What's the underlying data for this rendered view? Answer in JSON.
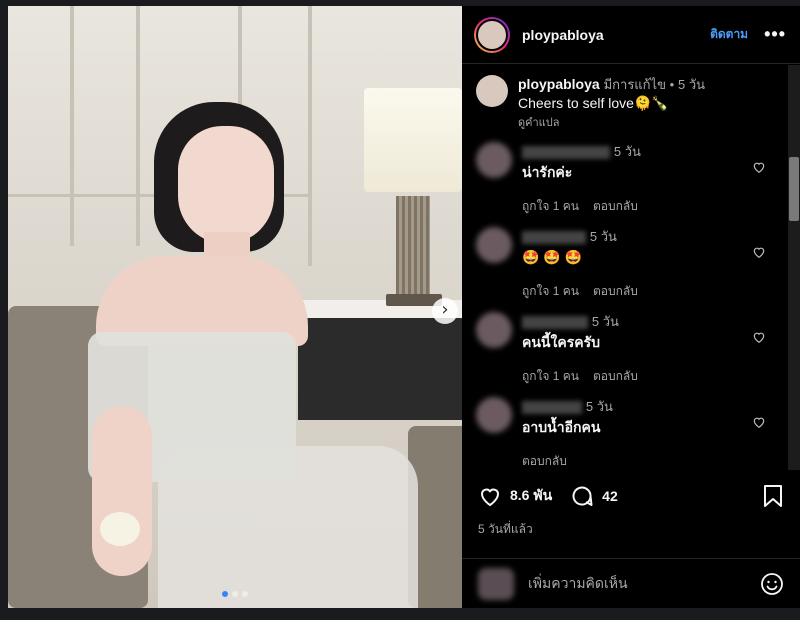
{
  "post": {
    "username": "ploypabloya",
    "follow_label": "ติดตาม",
    "more_label": "•••",
    "carousel": {
      "current_index": 1,
      "total": 3
    }
  },
  "caption": {
    "username": "ploypabloya",
    "edited_label": "มีการแก้ไข •",
    "time": "5 วัน",
    "text": "Cheers to self love🫠🍾",
    "translate_label": "ดูคำแปล"
  },
  "comments": [
    {
      "time": "5 วัน",
      "text": "น่ารักค่ะ",
      "likes_label": "ถูกใจ 1 คน",
      "reply_label": "ตอบกลับ"
    },
    {
      "time": "5 วัน",
      "text": "🤩 🤩 🤩",
      "likes_label": "ถูกใจ 1 คน",
      "reply_label": "ตอบกลับ"
    },
    {
      "time": "5 วัน",
      "text": "คนนี้ใครครับ",
      "likes_label": "ถูกใจ 1 คน",
      "reply_label": "ตอบกลับ"
    },
    {
      "time": "5 วัน",
      "text": "อาบน้ำอีกคน",
      "likes_label": "",
      "reply_label": "ตอบกลับ"
    }
  ],
  "actions": {
    "likes": "8.6 พัน",
    "comments": "42",
    "posted": "5 วันที่แล้ว"
  },
  "add_comment": {
    "placeholder": "เพิ่มความคิดเห็น"
  },
  "colors": {
    "accent": "#4a9df8",
    "background": "#000000",
    "muted": "#a8a8a8"
  },
  "icons": [
    "chevron-right-icon",
    "heart-icon",
    "comment-icon",
    "bookmark-icon",
    "smiley-icon",
    "more-icon"
  ]
}
